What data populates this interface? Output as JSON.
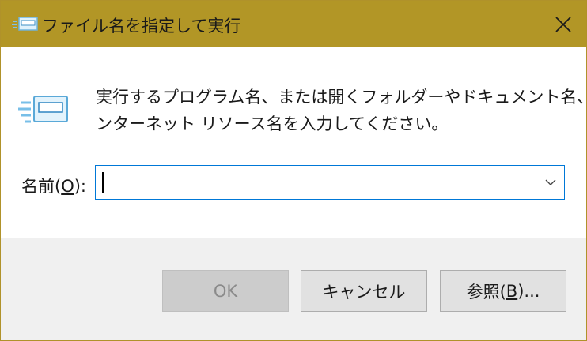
{
  "window": {
    "title": "ファイル名を指定して実行"
  },
  "description": {
    "line1": "実行するプログラム名、または開くフォルダーやドキュメント名、イ",
    "line2": "ンターネット リソース名を入力してください。"
  },
  "name_field": {
    "label_prefix": "名前(",
    "label_accel": "O",
    "label_suffix": "):",
    "value": ""
  },
  "buttons": {
    "ok_label": "OK",
    "cancel_label": "キャンセル",
    "browse_prefix": "参照(",
    "browse_accel": "B",
    "browse_suffix": ")..."
  },
  "icons": {
    "title": "run-icon",
    "close": "close-icon",
    "dropdown": "chevron-down-icon",
    "main": "run-icon"
  },
  "colors": {
    "titlebar": "#b29626",
    "focus_border": "#0078d7"
  }
}
